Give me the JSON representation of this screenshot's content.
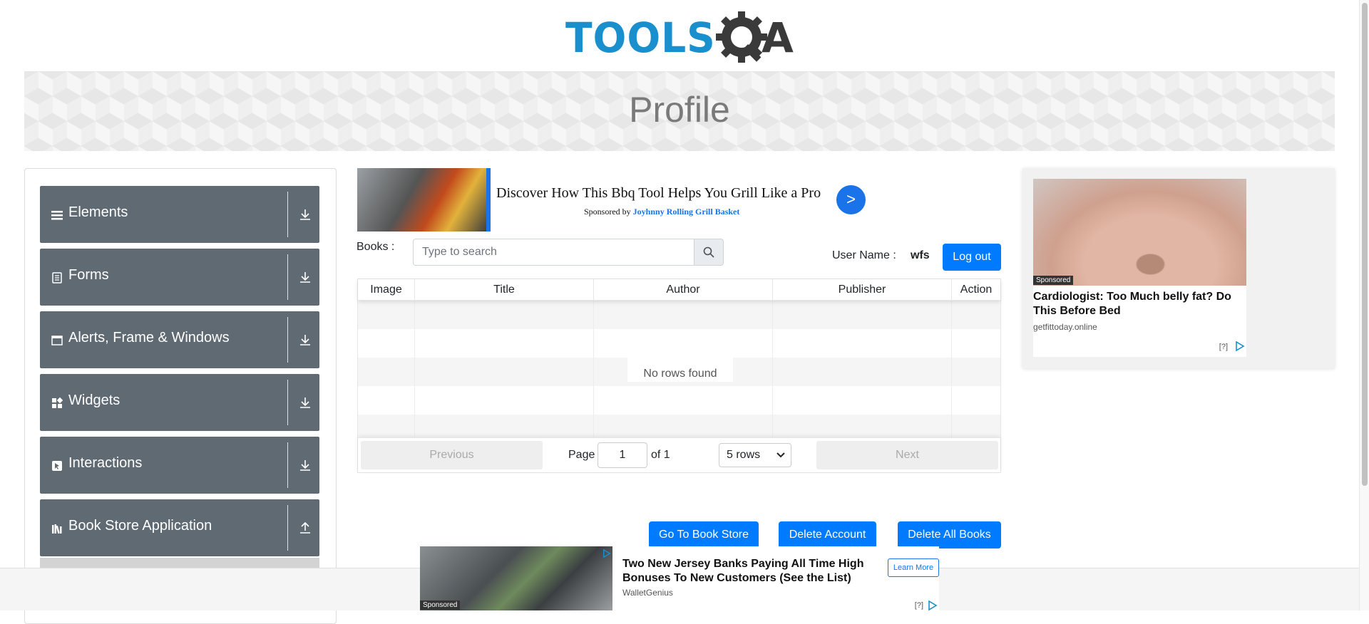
{
  "header": {
    "logo_text": "TOOLS",
    "logo_suffix": "A"
  },
  "banner": {
    "title": "Profile"
  },
  "sidebar": {
    "groups": [
      {
        "label": "Elements",
        "icon": "hamburger-icon",
        "arrow": "download-icon"
      },
      {
        "label": "Forms",
        "icon": "document-icon",
        "arrow": "download-icon"
      },
      {
        "label": "Alerts, Frame & Windows",
        "icon": "window-icon",
        "arrow": "download-icon"
      },
      {
        "label": "Widgets",
        "icon": "grid-icon",
        "arrow": "download-icon"
      },
      {
        "label": "Interactions",
        "icon": "cursor-icon",
        "arrow": "download-icon"
      },
      {
        "label": "Book Store Application",
        "icon": "books-icon",
        "arrow": "upload-icon"
      }
    ]
  },
  "ad_top": {
    "headline": "Discover How This Bbq Tool Helps You Grill Like a Pro",
    "sponsored_prefix": "Sponsored by",
    "sponsor": "Joyhnny Rolling Grill Basket",
    "go_label": ">"
  },
  "search": {
    "label": "Books :",
    "placeholder": "Type to search"
  },
  "user": {
    "label": "User Name :",
    "value": "wfs",
    "logout_label": "Log out"
  },
  "table": {
    "columns": [
      "Image",
      "Title",
      "Author",
      "Publisher",
      "Action"
    ],
    "empty_text": "No rows found"
  },
  "pagination": {
    "previous": "Previous",
    "page_label": "Page",
    "page_value": "1",
    "of_label": "of 1",
    "rows_option": "5 rows",
    "next": "Next"
  },
  "actions": {
    "go_to_store": "Go To Book Store",
    "delete_account": "Delete Account",
    "delete_all_books": "Delete All Books"
  },
  "ad_right": {
    "sponsored": "Sponsored",
    "title": "Cardiologist: Too Much belly fat? Do This Before Bed",
    "domain": "getfittoday.online",
    "info": "[?]"
  },
  "ad_bottom": {
    "sponsored": "Sponsored",
    "title": "Two New Jersey Banks Paying All Time High Bonuses To New Customers (See the List)",
    "domain": "WalletGenius",
    "cta": "Learn More",
    "info": "[?]"
  },
  "colors": {
    "brand_blue": "#1a8fce",
    "primary": "#007bff",
    "sidebar_bg": "#5f6a73"
  }
}
